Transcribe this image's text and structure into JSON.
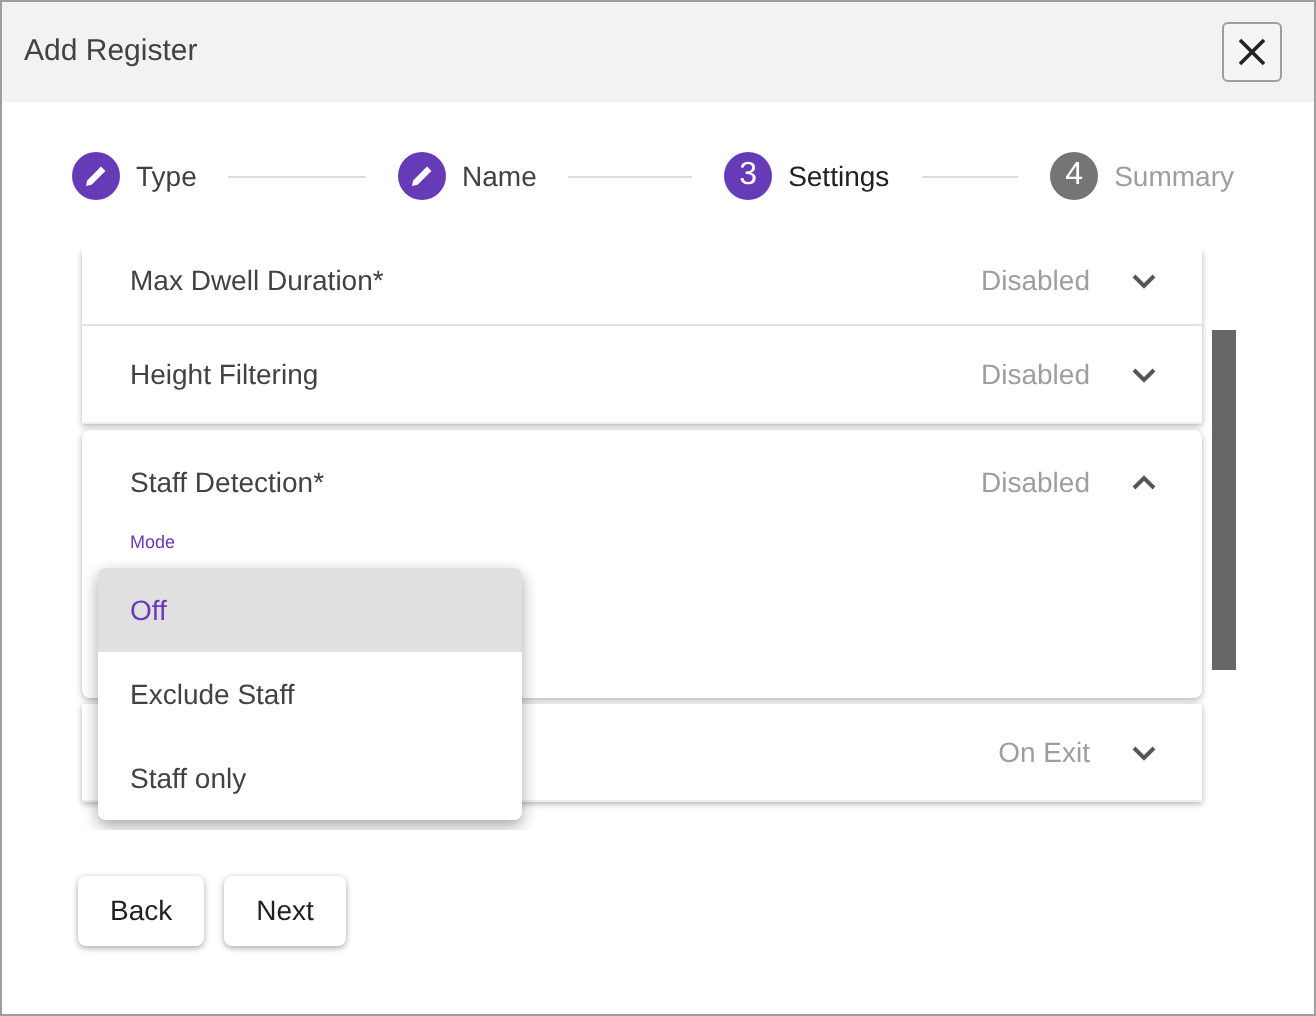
{
  "window": {
    "title": "Add Register"
  },
  "steps": [
    {
      "label": "Type",
      "completed": true,
      "active": false
    },
    {
      "label": "Name",
      "completed": true,
      "active": false
    },
    {
      "number": "3",
      "label": "Settings",
      "completed": false,
      "active": true
    },
    {
      "number": "4",
      "label": "Summary",
      "completed": false,
      "active": false
    }
  ],
  "panels": [
    {
      "title": "Max Dwell Duration*",
      "value": "Disabled",
      "expanded": false
    },
    {
      "title": "Height Filtering",
      "value": "Disabled",
      "expanded": false
    },
    {
      "title": "Staff Detection*",
      "value": "Disabled",
      "expanded": true,
      "field_label": "Mode"
    },
    {
      "value": "On Exit",
      "expanded": false
    }
  ],
  "menu": [
    {
      "label": "Off",
      "selected": true
    },
    {
      "label": "Exclude Staff",
      "selected": false
    },
    {
      "label": "Staff only",
      "selected": false
    }
  ],
  "buttons": [
    "Back",
    "Next"
  ]
}
